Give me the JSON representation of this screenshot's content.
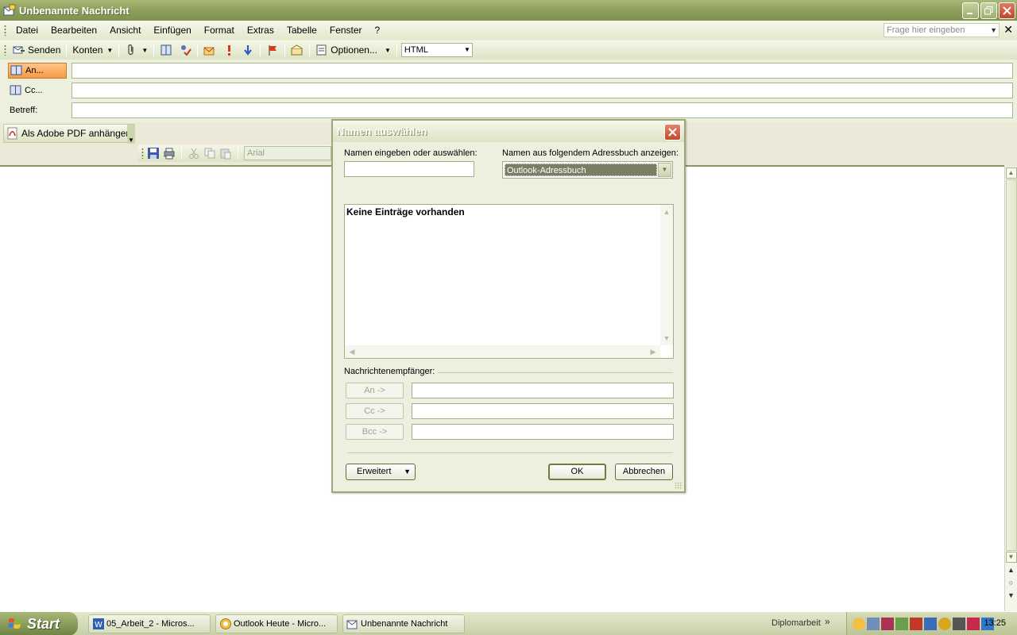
{
  "window": {
    "title": "Unbenannte Nachricht"
  },
  "menu": {
    "items": [
      "Datei",
      "Bearbeiten",
      "Ansicht",
      "Einfügen",
      "Format",
      "Extras",
      "Tabelle",
      "Fenster",
      "?"
    ],
    "help_placeholder": "Frage hier eingeben"
  },
  "toolbar": {
    "send": "Senden",
    "accounts": "Konten",
    "options": "Optionen...",
    "format_value": "HTML"
  },
  "fields": {
    "to_label": "An...",
    "cc_label": "Cc...",
    "subject_label": "Betreff:"
  },
  "adobe": {
    "label": "Als Adobe PDF anhängen"
  },
  "format_toolbar": {
    "font": "Arial"
  },
  "dialog": {
    "title": "Namen auswählen",
    "search_label": "Namen eingeben oder auswählen:",
    "addressbook_label": "Namen aus folgendem Adressbuch anzeigen:",
    "addressbook_value": "Outlook-Adressbuch",
    "empty_text": "Keine Einträge vorhanden",
    "recipients_label": "Nachrichtenempfänger:",
    "to_btn": "An ->",
    "cc_btn": "Cc ->",
    "bcc_btn": "Bcc ->",
    "advanced_btn": "Erweitert",
    "ok_btn": "OK",
    "cancel_btn": "Abbrechen"
  },
  "taskbar": {
    "start": "Start",
    "tasks": [
      "05_Arbeit_2 - Micros...",
      "Outlook Heute - Micro...",
      "Unbenannte Nachricht"
    ],
    "tray_label": "Diplomarbeit",
    "clock": "13:25"
  },
  "colors": {
    "title_gradient": "#8FA05E",
    "active_field": "#F79A43",
    "close_red": "#C14A30"
  }
}
